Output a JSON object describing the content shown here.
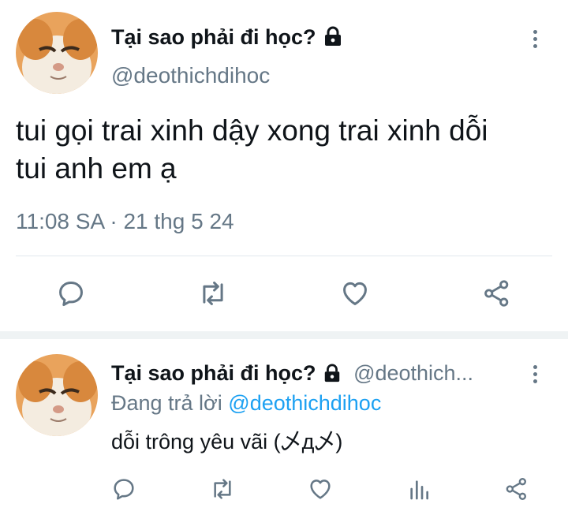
{
  "tweet": {
    "display_name": "Tại sao phải đi học?",
    "handle": "@deothichdihoc",
    "text_line1": "tui gọi trai xinh dậy xong trai xinh dỗi",
    "text_line2": "tui anh em ạ",
    "timestamp": "11:08 SA · 21 thg 5 24"
  },
  "reply": {
    "display_name": "Tại sao phải đi học?",
    "handle": "@deothich...",
    "replying_prefix": "Đang trả lời",
    "replying_handle": "@deothichdihoc",
    "text": "dỗi trông yêu vãi (乄д乄)"
  },
  "icons": {
    "more": "more-vertical-icon",
    "lock": "lock-icon",
    "reply": "reply-icon",
    "retweet": "retweet-icon",
    "like": "heart-icon",
    "share": "share-icon",
    "analytics": "analytics-icon"
  },
  "colors": {
    "text": "#0f1419",
    "muted": "#657786",
    "accent": "#1da1f2",
    "divider": "#e1e8ed"
  }
}
